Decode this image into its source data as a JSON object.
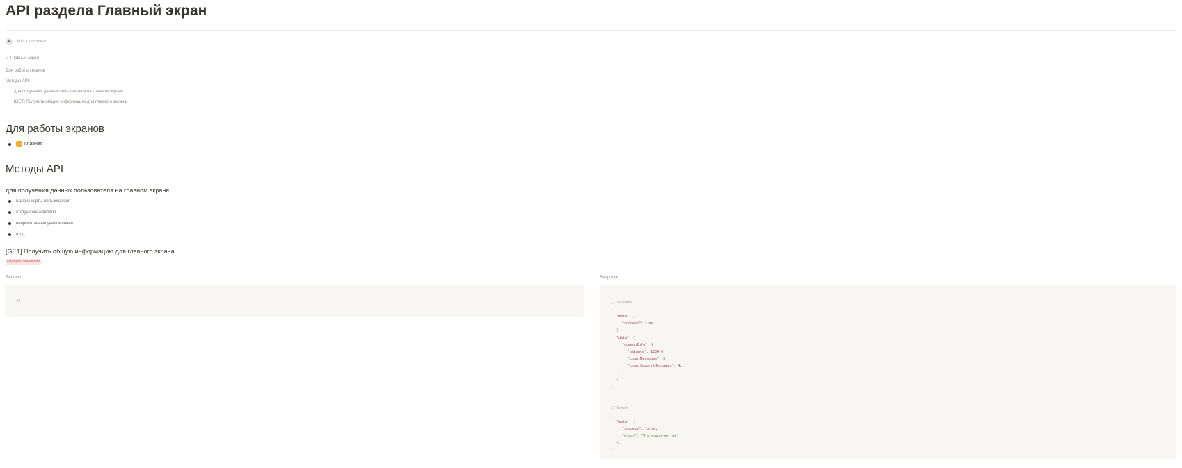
{
  "page": {
    "title": "API раздела Главный экран"
  },
  "comment": {
    "avatar_icon": "person-icon",
    "placeholder": "Add a comment..."
  },
  "toc": {
    "items": [
      {
        "label": "Главный экран",
        "icon": "check-icon"
      },
      {
        "label": "Для работы экранов"
      },
      {
        "label": "Методы API"
      },
      {
        "label": "для получения данных пользователя на главном экране"
      },
      {
        "label": "[GET] Получить общую информацию для главного экрана"
      }
    ]
  },
  "screens_section": {
    "heading": "Для работы экранов",
    "link_label": "Главная",
    "link_icon": "folder-icon"
  },
  "api_section": {
    "heading": "Методы API",
    "subheading": "для получения данных пользователя на главном экране",
    "bullets": [
      "Баланс карты пользователя",
      "статус пользователя",
      "непрочитанные уведомления",
      "и т.д."
    ],
    "method_title": "[GET] Получить общую информацию для главного экрана",
    "endpoint": "/user/get-content-info"
  },
  "request": {
    "label": "Request",
    "code": "{}"
  },
  "response": {
    "label": "Response",
    "lines": [
      {
        "text": "// Success",
        "cls": "c-comment",
        "indent": 0
      },
      {
        "text": "{",
        "cls": "c-punc",
        "indent": 0
      },
      {
        "text": "\"meta\": {",
        "cls": "c-key",
        "indent": 1
      },
      {
        "text": "\"success\": true",
        "cls": "c-key",
        "indent": 2
      },
      {
        "text": "},",
        "cls": "c-punc",
        "indent": 1
      },
      {
        "text": "\"data\": {",
        "cls": "c-key",
        "indent": 1
      },
      {
        "text": "\"commonInfo\": {",
        "cls": "c-key",
        "indent": 2
      },
      {
        "text": "\"balance\": 1234.0,",
        "cls": "c-key",
        "indent": 3
      },
      {
        "text": "\"countMessages\": 3,",
        "cls": "c-key",
        "indent": 3
      },
      {
        "text": "\"countSupportMessages\": 4,",
        "cls": "c-key",
        "indent": 3
      },
      {
        "text": "}",
        "cls": "c-punc",
        "indent": 2
      },
      {
        "text": "}",
        "cls": "c-punc",
        "indent": 1
      },
      {
        "text": "}",
        "cls": "c-punc",
        "indent": 0
      },
      {
        "text": "",
        "cls": "c-punc",
        "indent": 0
      },
      {
        "text": "",
        "cls": "c-punc",
        "indent": 0
      },
      {
        "text": "// Error",
        "cls": "c-comment",
        "indent": 0
      },
      {
        "text": "{",
        "cls": "c-punc",
        "indent": 0
      },
      {
        "text": "\"meta\": {",
        "cls": "c-key",
        "indent": 1
      },
      {
        "text": "\"success\": false,",
        "cls": "c-key",
        "indent": 2
      },
      {
        "text": "\"error\": \"Что-пошло-не-так\"",
        "cls": "c-str",
        "indent": 2
      },
      {
        "text": "},",
        "cls": "c-punc",
        "indent": 1
      },
      {
        "text": "}",
        "cls": "c-punc",
        "indent": 0
      }
    ]
  }
}
